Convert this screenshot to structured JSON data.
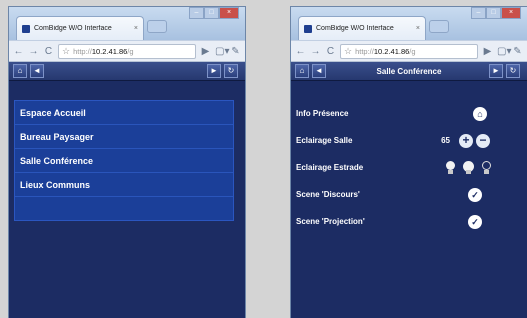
{
  "left": {
    "tab_title": "ComBidge W/O Interface",
    "url": {
      "proto": "http://",
      "host": "10.2.41.86",
      "rest": "/g"
    },
    "app_title": "",
    "menu": [
      {
        "label": "Espace Accueil"
      },
      {
        "label": "Bureau Paysager"
      },
      {
        "label": "Salle Conférence"
      },
      {
        "label": "Lieux Communs"
      },
      {
        "label": ""
      }
    ]
  },
  "right": {
    "tab_title": "ComBidge W/O Interface",
    "url": {
      "proto": "http://",
      "host": "10.2.41.86",
      "rest": "/g"
    },
    "app_title": "Salle Conférence",
    "rows": {
      "presence": {
        "label": "Info Présence"
      },
      "eclairage_salle": {
        "label": "Eclairage Salle",
        "value": "65"
      },
      "eclairage_estrade": {
        "label": "Eclairage Estrade"
      },
      "scene_discours": {
        "label": "Scene 'Discours'"
      },
      "scene_projection": {
        "label": "Scene 'Projection'"
      }
    }
  },
  "icons": {
    "home": "⌂",
    "back": "◄",
    "forward": "►",
    "refresh": "↻",
    "check": "✓",
    "plus": "+",
    "minus": "−"
  }
}
